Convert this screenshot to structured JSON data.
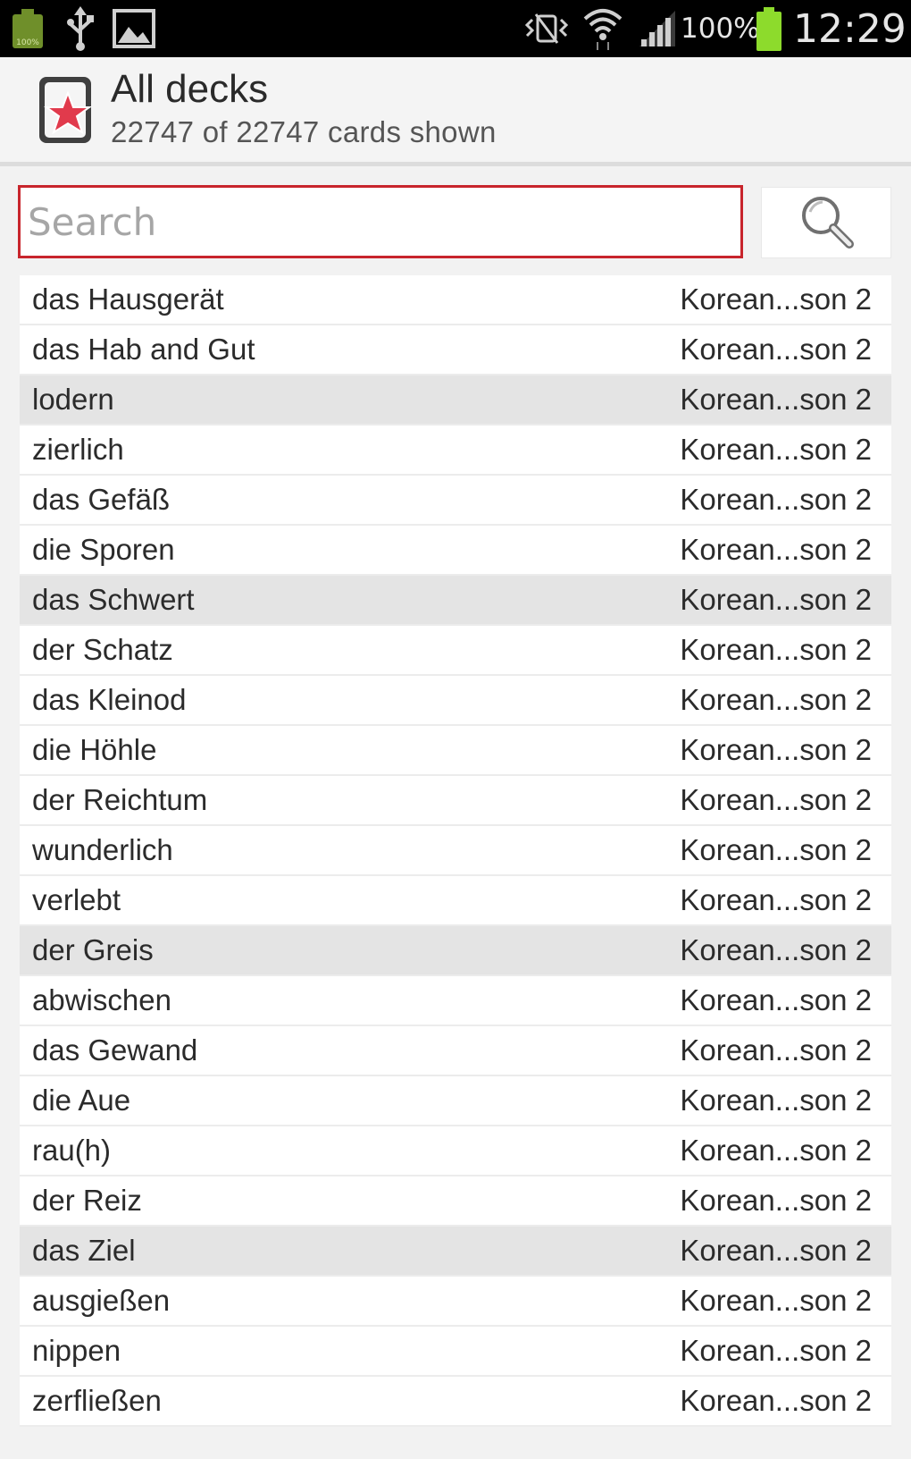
{
  "status_bar": {
    "icons": [
      "battery-saver-icon",
      "usb-icon",
      "image-icon",
      "vibrate-icon",
      "wifi-icon",
      "signal-icon",
      "battery-icon"
    ],
    "battery_label": "100%",
    "battery_small_label": "100%",
    "time": "12:29"
  },
  "header": {
    "title": "All decks",
    "subtitle": "22747 of 22747 cards shown"
  },
  "search": {
    "placeholder": "Search",
    "value": ""
  },
  "colors": {
    "accent_red": "#c8252c",
    "battery_green": "#8ddb2c",
    "marked_row": "#e4e4e4"
  },
  "cards": [
    {
      "term": "das Hausgerät",
      "deck": "Korean...son 2",
      "marked": false
    },
    {
      "term": "das Hab and Gut",
      "deck": "Korean...son 2",
      "marked": false
    },
    {
      "term": "lodern",
      "deck": "Korean...son 2",
      "marked": true
    },
    {
      "term": "zierlich",
      "deck": "Korean...son 2",
      "marked": false
    },
    {
      "term": "das Gefäß",
      "deck": "Korean...son 2",
      "marked": false
    },
    {
      "term": "die Sporen",
      "deck": "Korean...son 2",
      "marked": false
    },
    {
      "term": "das Schwert",
      "deck": "Korean...son 2",
      "marked": true
    },
    {
      "term": "der Schatz",
      "deck": "Korean...son 2",
      "marked": false
    },
    {
      "term": "das Kleinod",
      "deck": "Korean...son 2",
      "marked": false
    },
    {
      "term": "die Höhle",
      "deck": "Korean...son 2",
      "marked": false
    },
    {
      "term": "der Reichtum",
      "deck": "Korean...son 2",
      "marked": false
    },
    {
      "term": "wunderlich",
      "deck": "Korean...son 2",
      "marked": false
    },
    {
      "term": "verlebt",
      "deck": "Korean...son 2",
      "marked": false
    },
    {
      "term": "der Greis",
      "deck": "Korean...son 2",
      "marked": true
    },
    {
      "term": "abwischen",
      "deck": "Korean...son 2",
      "marked": false
    },
    {
      "term": "das Gewand",
      "deck": "Korean...son 2",
      "marked": false
    },
    {
      "term": "die Aue",
      "deck": "Korean...son 2",
      "marked": false
    },
    {
      "term": "rau(h)",
      "deck": "Korean...son 2",
      "marked": false
    },
    {
      "term": "der Reiz",
      "deck": "Korean...son 2",
      "marked": false
    },
    {
      "term": "das Ziel",
      "deck": "Korean...son 2",
      "marked": true
    },
    {
      "term": "ausgießen",
      "deck": "Korean...son 2",
      "marked": false
    },
    {
      "term": "nippen",
      "deck": "Korean...son 2",
      "marked": false
    },
    {
      "term": "zerfließen",
      "deck": "Korean...son 2",
      "marked": false
    }
  ]
}
